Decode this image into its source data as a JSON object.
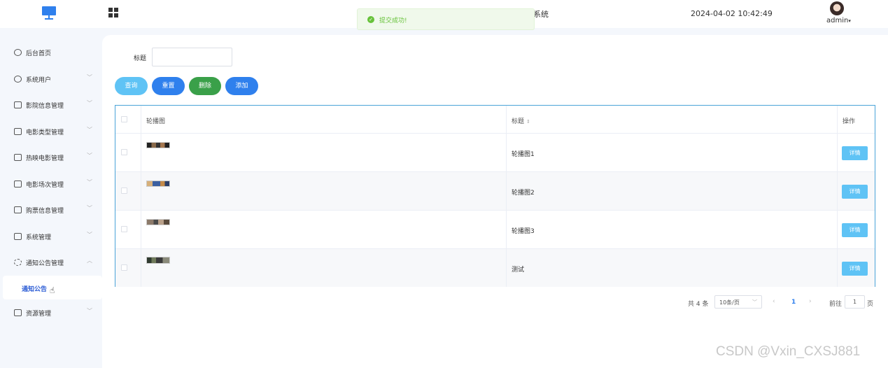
{
  "header": {
    "title_fragment": "系统",
    "datetime": "2024-04-02 10:42:49",
    "user": "admin",
    "caret": "▾"
  },
  "toast": {
    "message": "提交成功!",
    "icon": "check-circle-icon",
    "color": "#67c23a"
  },
  "sidebar": {
    "items": [
      {
        "label": "后台首页",
        "icon": "clock-icon",
        "chevron": ""
      },
      {
        "label": "系统用户",
        "icon": "user-icon",
        "chevron": "﹀"
      },
      {
        "label": "影院信息管理",
        "icon": "card-icon",
        "chevron": "﹀"
      },
      {
        "label": "电影类型管理",
        "icon": "card-icon",
        "chevron": "﹀"
      },
      {
        "label": "热映电影管理",
        "icon": "card-icon",
        "chevron": "﹀"
      },
      {
        "label": "电影场次管理",
        "icon": "card-icon",
        "chevron": "﹀"
      },
      {
        "label": "购票信息管理",
        "icon": "card-icon",
        "chevron": "﹀"
      },
      {
        "label": "系统管理",
        "icon": "folder-icon",
        "chevron": "﹀"
      },
      {
        "label": "通知公告管理",
        "icon": "sparkle-icon",
        "chevron": "︿"
      },
      {
        "label": "资源管理",
        "icon": "box-icon",
        "chevron": "﹀"
      }
    ],
    "active_sub": "通知公告"
  },
  "search": {
    "label": "标题",
    "value": "",
    "placeholder": ""
  },
  "buttons": {
    "query": "查询",
    "reset": "重置",
    "delete": "删除",
    "add": "添加"
  },
  "table": {
    "headers": {
      "image": "轮播图",
      "title": "标题",
      "sort_icon": "⇕",
      "op": "操作"
    },
    "rows": [
      {
        "title": "轮播图1",
        "op": "详情"
      },
      {
        "title": "轮播图2",
        "op": "详情"
      },
      {
        "title": "轮播图3",
        "op": "详情"
      },
      {
        "title": "测试",
        "op": "详情"
      }
    ]
  },
  "pagination": {
    "total": "共 4 条",
    "page_size": "10条/页",
    "current_page": "1",
    "prev": "‹",
    "next": "›",
    "goto_label": "前往",
    "goto_value": "1",
    "unit": "页"
  },
  "watermark": "CSDN @Vxin_CXSJ881",
  "colors": {
    "primary": "#2f80ed",
    "info": "#5fc3f5",
    "success": "#3aa049",
    "table_border": "#4aa3d8"
  }
}
